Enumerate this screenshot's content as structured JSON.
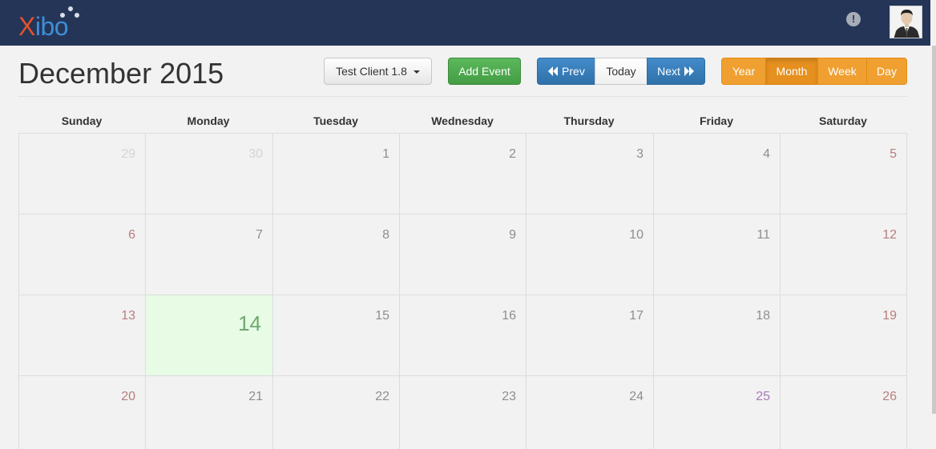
{
  "brand": {
    "logo_x": "X",
    "logo_rest": "ibo"
  },
  "header": {
    "title": "December 2015",
    "display_select": "Test Client 1.8",
    "add_event": "Add Event",
    "nav": {
      "prev": "Prev",
      "today": "Today",
      "next": "Next"
    },
    "views": {
      "year": "Year",
      "month": "Month",
      "week": "Week",
      "day": "Day"
    }
  },
  "calendar": {
    "weekdays": [
      "Sunday",
      "Monday",
      "Tuesday",
      "Wednesday",
      "Thursday",
      "Friday",
      "Saturday"
    ],
    "weeks": [
      [
        "29",
        "30",
        "1",
        "2",
        "3",
        "4",
        "5"
      ],
      [
        "6",
        "7",
        "8",
        "9",
        "10",
        "11",
        "12"
      ],
      [
        "13",
        "14",
        "15",
        "16",
        "17",
        "18",
        "19"
      ],
      [
        "20",
        "21",
        "22",
        "23",
        "24",
        "25",
        "26"
      ]
    ]
  },
  "colors": {
    "topbar": "#253558",
    "today_bg": "#e7fbe5",
    "weekend_text": "#b97d7d",
    "holiday_text": "#a77ab5",
    "primary": "#428bca",
    "success": "#5cb85c",
    "warning": "#f0a030"
  },
  "icons": {
    "alert": "exclamation-circle-icon",
    "prev": "double-chevron-left-icon",
    "next": "double-chevron-right-icon",
    "caret": "caret-down-icon",
    "avatar": "user-avatar"
  }
}
